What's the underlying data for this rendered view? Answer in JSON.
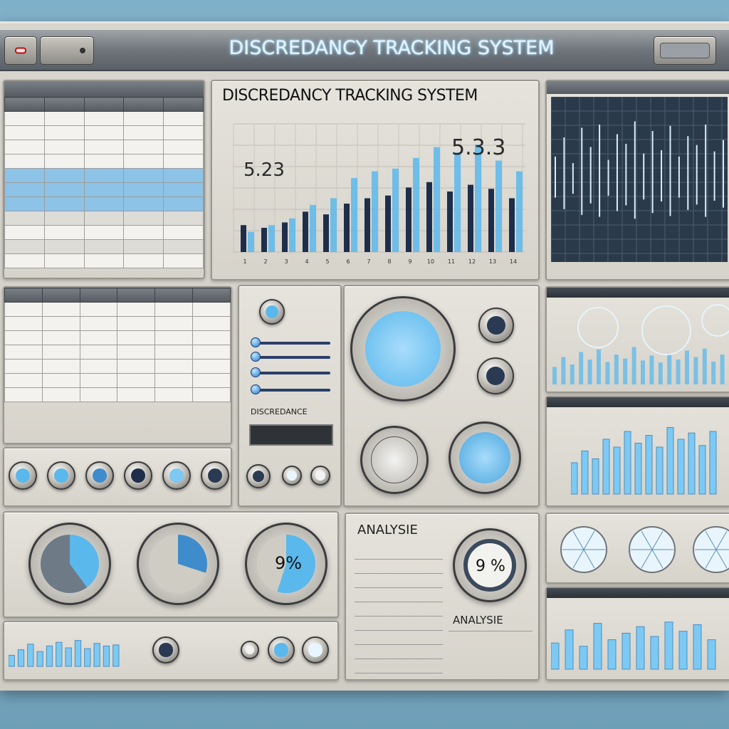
{
  "app": {
    "title": "DISCREDANCY TRACKING SYSTEM",
    "panel_title": "DISCREDANCY TRACKING SYSTEM"
  },
  "colors": {
    "accent": "#5ab8ec",
    "dark_bar": "#1e2e4a",
    "panel": "#dedcd6"
  },
  "chart_main": {
    "left_value": "5.23",
    "right_value": "5.3.3"
  },
  "chart_data": [
    {
      "type": "bar",
      "categories": [
        "1",
        "2",
        "3",
        "4",
        "5",
        "6",
        "7",
        "8",
        "9",
        "10",
        "11",
        "12",
        "13",
        "14"
      ],
      "series": [
        {
          "values": [
            20,
            18,
            22,
            30,
            28,
            36,
            40,
            42,
            48,
            52,
            45,
            50,
            47,
            40
          ]
        },
        {
          "values": [
            15,
            20,
            25,
            35,
            40,
            55,
            60,
            62,
            70,
            78,
            74,
            80,
            68,
            60
          ]
        }
      ]
    },
    {
      "type": "line",
      "x": [
        1,
        2,
        3,
        4,
        5,
        6,
        7,
        8,
        9,
        10,
        11,
        12,
        13,
        14,
        15,
        16,
        17,
        18,
        19,
        20
      ],
      "values": [
        40,
        70,
        30,
        85,
        55,
        90,
        35,
        75,
        60,
        95,
        45,
        80,
        50,
        88,
        40,
        72,
        58,
        90,
        48,
        66
      ]
    },
    {
      "type": "bar",
      "values": [
        35,
        55,
        40,
        65,
        50,
        70,
        45,
        60,
        52,
        75,
        48,
        58,
        44,
        62,
        50,
        68,
        55,
        72,
        46,
        60
      ]
    },
    {
      "type": "bar",
      "values": [
        40,
        55,
        45,
        70,
        60,
        80,
        65,
        75,
        60,
        85,
        70,
        78,
        62,
        80
      ]
    },
    {
      "type": "bar",
      "values": [
        30,
        45,
        60,
        40,
        55,
        65,
        50,
        70,
        48,
        62,
        55,
        58
      ]
    },
    {
      "type": "bar",
      "values": [
        40,
        60,
        35,
        70,
        45,
        55,
        65,
        50,
        72,
        58,
        68,
        45
      ]
    }
  ],
  "table1": {
    "headers": [
      "",
      "",
      "",
      "",
      ""
    ],
    "rows": [
      {
        "cls": "alt",
        "cells": [
          "",
          "",
          "",
          "",
          ""
        ]
      },
      {
        "cls": "alt",
        "cells": [
          "",
          "",
          "",
          "",
          ""
        ]
      },
      {
        "cls": "alt",
        "cells": [
          "",
          "",
          "",
          "",
          ""
        ]
      },
      {
        "cls": "alt",
        "cells": [
          "",
          "",
          "",
          "",
          ""
        ]
      },
      {
        "cls": "hl",
        "cells": [
          "",
          "",
          "",
          "",
          ""
        ]
      },
      {
        "cls": "hl",
        "cells": [
          "",
          "",
          "",
          "",
          ""
        ]
      },
      {
        "cls": "hl",
        "cells": [
          "",
          "",
          "",
          "",
          ""
        ]
      },
      {
        "cls": "plain",
        "cells": [
          "",
          "",
          "",
          "",
          ""
        ]
      },
      {
        "cls": "alt",
        "cells": [
          "",
          "",
          "",
          "",
          ""
        ]
      },
      {
        "cls": "plain",
        "cells": [
          "",
          "",
          "",
          "",
          ""
        ]
      },
      {
        "cls": "alt",
        "cells": [
          "",
          "",
          "",
          "",
          ""
        ]
      }
    ]
  },
  "table2": {
    "headers": [
      "",
      "",
      "",
      "",
      "",
      ""
    ],
    "rows": [
      {
        "cls": "alt",
        "cells": [
          "",
          "",
          "",
          "",
          "",
          ""
        ]
      },
      {
        "cls": "alt",
        "cells": [
          "",
          "",
          "",
          "",
          "",
          ""
        ]
      },
      {
        "cls": "alt",
        "cells": [
          "",
          "",
          "",
          "",
          "",
          ""
        ]
      },
      {
        "cls": "alt",
        "cells": [
          "",
          "",
          "",
          "",
          "",
          ""
        ]
      },
      {
        "cls": "alt",
        "cells": [
          "",
          "",
          "",
          "",
          "",
          ""
        ]
      },
      {
        "cls": "alt",
        "cells": [
          "",
          "",
          "",
          "",
          "",
          ""
        ]
      },
      {
        "cls": "alt",
        "cells": [
          "",
          "",
          "",
          "",
          "",
          ""
        ]
      }
    ]
  },
  "controls": {
    "discrepance_label": "DISCREDANCE",
    "display_value": ""
  },
  "gauges": {
    "percent_1": "9%",
    "percent_2": "9 %"
  },
  "analysis": {
    "title": "ANALYSIE",
    "subtitle": "ANALYSIE",
    "rows": [
      "",
      "",
      "",
      "",
      "",
      "",
      "",
      "",
      ""
    ]
  }
}
